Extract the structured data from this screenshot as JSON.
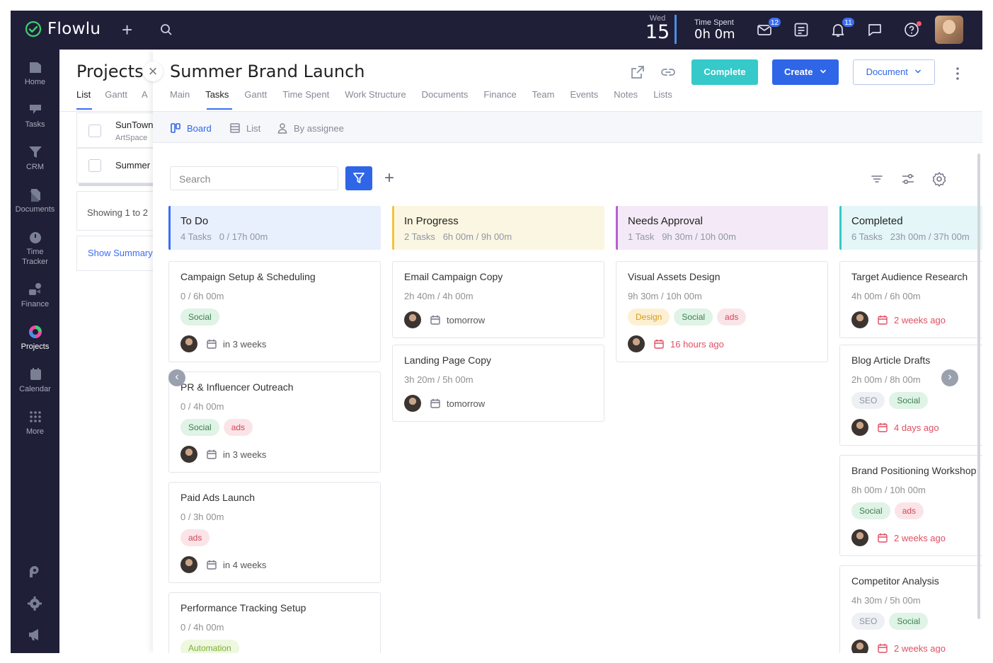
{
  "topbar": {
    "logo_text": "Flowlu",
    "date_day": "Wed",
    "date_num": "15",
    "time_spent_label": "Time Spent",
    "time_spent_value": "0h 0m",
    "mail_badge": "12",
    "notif_badge": "11"
  },
  "sidebar": {
    "items": [
      {
        "label": "Home",
        "icon": "home-icon"
      },
      {
        "label": "Tasks",
        "icon": "tasks-icon"
      },
      {
        "label": "CRM",
        "icon": "crm-icon"
      },
      {
        "label": "Documents",
        "icon": "documents-icon"
      },
      {
        "label": "Time",
        "label2": "Tracker",
        "icon": "time-tracker-icon"
      },
      {
        "label": "Finance",
        "icon": "finance-icon"
      },
      {
        "label": "Projects",
        "icon": "projects-icon"
      },
      {
        "label": "Calendar",
        "icon": "calendar-icon"
      },
      {
        "label": "More",
        "icon": "more-icon"
      }
    ]
  },
  "projects": {
    "title": "Projects",
    "tabs": [
      "List",
      "Gantt",
      "A"
    ],
    "rows": [
      {
        "name": "SunTown",
        "sub": "ArtSpace"
      },
      {
        "name": "Summer",
        "sub": ""
      }
    ],
    "showing": "Showing 1 to 2",
    "show_summary": "Show Summary"
  },
  "detail": {
    "title": "Summer Brand Launch",
    "tabs": [
      "Main",
      "Tasks",
      "Gantt",
      "Time Spent",
      "Work Structure",
      "Documents",
      "Finance",
      "Team",
      "Events",
      "Notes",
      "Lists"
    ],
    "complete_label": "Complete",
    "create_label": "Create",
    "document_label": "Document",
    "views": [
      "Board",
      "List",
      "By assignee"
    ],
    "search_placeholder": "Search"
  },
  "colors": {
    "todo": "#e8effd",
    "todo_bar": "#3b6ef5",
    "inprogress": "#fbf6e1",
    "inprogress_bar": "#f0c53c",
    "approval": "#f4eaf7",
    "approval_bar": "#b860cf",
    "completed": "#e4f6f7",
    "completed_bar": "#35c9c9",
    "accent": "#2f66e8"
  },
  "board": {
    "columns": [
      {
        "name": "To Do",
        "tasks": "4 Tasks",
        "time": "0 / 17h 00m",
        "cards": [
          {
            "title": "Campaign Setup & Scheduling",
            "time": "0 / 6h 00m",
            "tags": [
              "Social"
            ],
            "due": "in 3 weeks"
          },
          {
            "title": "PR & Influencer Outreach",
            "time": "0 / 4h 00m",
            "tags": [
              "Social",
              "ads"
            ],
            "due": "in 3 weeks"
          },
          {
            "title": "Paid Ads Launch",
            "time": "0 / 3h 00m",
            "tags": [
              "ads"
            ],
            "due": "in 4 weeks"
          },
          {
            "title": "Performance Tracking Setup",
            "time": "0 / 4h 00m",
            "tags": [
              "Automation"
            ],
            "due": ""
          }
        ]
      },
      {
        "name": "In Progress",
        "tasks": "2 Tasks",
        "time": "6h 00m / 9h 00m",
        "cards": [
          {
            "title": "Email Campaign Copy",
            "time": "2h 40m / 4h 00m",
            "tags": [],
            "due": "tomorrow"
          },
          {
            "title": "Landing Page Copy",
            "time": "3h 20m / 5h 00m",
            "tags": [],
            "due": "tomorrow"
          }
        ]
      },
      {
        "name": "Needs Approval",
        "tasks": "1 Task",
        "time": "9h 30m / 10h 00m",
        "cards": [
          {
            "title": "Visual Assets Design",
            "time": "9h 30m / 10h 00m",
            "tags": [
              "Design",
              "Social",
              "ads"
            ],
            "due": "16 hours ago"
          }
        ]
      },
      {
        "name": "Completed",
        "tasks": "6 Tasks",
        "time": "23h 00m / 37h 00m",
        "cards": [
          {
            "title": "Target Audience Research",
            "time": "4h 00m / 6h 00m",
            "tags": [],
            "due": "2 weeks ago"
          },
          {
            "title": "Blog Article Drafts",
            "time": "2h 00m / 8h 00m",
            "tags": [
              "SEO",
              "Social"
            ],
            "due": "4 days ago"
          },
          {
            "title": "Brand Positioning Workshop",
            "time": "8h 00m / 10h 00m",
            "tags": [
              "Social",
              "ads"
            ],
            "due": "2 weeks ago"
          },
          {
            "title": "Competitor Analysis",
            "time": "4h 30m / 5h 00m",
            "tags": [
              "SEO",
              "Social"
            ],
            "due": "2 weeks ago"
          }
        ]
      }
    ]
  }
}
